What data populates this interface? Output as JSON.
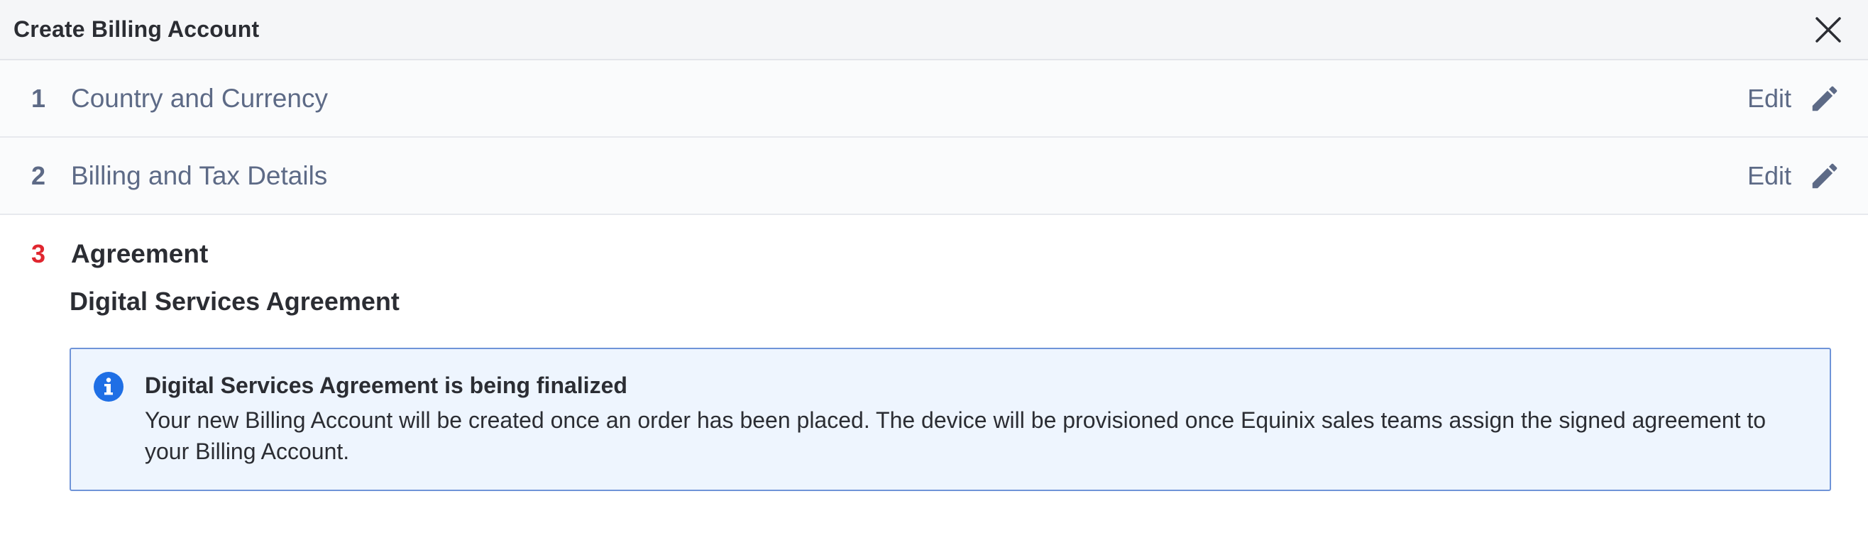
{
  "dialog": {
    "title": "Create Billing Account",
    "close_icon": "close-icon"
  },
  "steps": [
    {
      "number": "1",
      "title": "Country and Currency",
      "edit_label": "Edit",
      "icon": "pencil-icon"
    },
    {
      "number": "2",
      "title": "Billing and Tax Details",
      "edit_label": "Edit",
      "icon": "pencil-icon"
    }
  ],
  "active_step": {
    "number": "3",
    "title": "Agreement",
    "subheading": "Digital Services Agreement"
  },
  "info_notice": {
    "icon": "info-icon",
    "title": "Digital Services Agreement is being finalized",
    "body": "Your new Billing Account will be created once an order has been placed. The device will be provisioned once Equinix sales teams assign the signed agreement to your Billing Account."
  },
  "colors": {
    "active_step_number": "#e0262f",
    "info_border": "#6f94d8",
    "info_background": "#eef5fe",
    "info_icon": "#1f6fe5",
    "muted_text": "#5d6a86"
  }
}
